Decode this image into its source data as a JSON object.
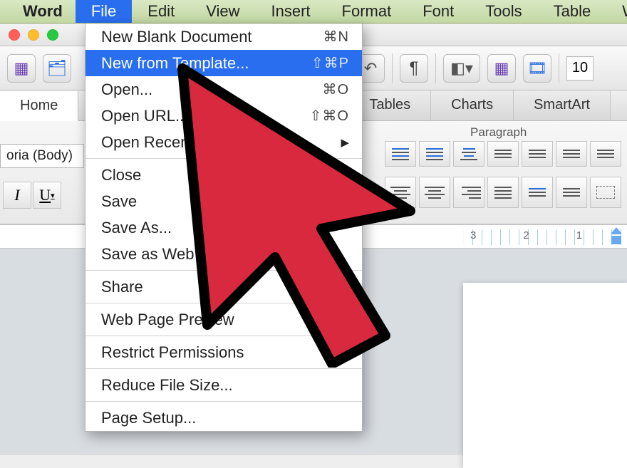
{
  "menubar": {
    "app_name": "Word",
    "items": [
      "File",
      "Edit",
      "View",
      "Insert",
      "Format",
      "Font",
      "Tools",
      "Table",
      "W"
    ],
    "active_index": 0
  },
  "dropdown": {
    "highlight_index": 1,
    "groups": [
      [
        {
          "label": "New Blank Document",
          "shortcut": "⌘N"
        },
        {
          "label": "New from Template...",
          "shortcut": "⇧⌘P"
        },
        {
          "label": "Open...",
          "shortcut": "⌘O"
        },
        {
          "label": "Open URL...",
          "shortcut": "⇧⌘O"
        },
        {
          "label": "Open Recent",
          "submenu": true
        }
      ],
      [
        {
          "label": "Close"
        },
        {
          "label": "Save"
        },
        {
          "label": "Save As..."
        },
        {
          "label": "Save as Web Page..."
        }
      ],
      [
        {
          "label": "Share",
          "submenu": true
        }
      ],
      [
        {
          "label": "Web Page Preview"
        }
      ],
      [
        {
          "label": "Restrict Permissions",
          "submenu": true
        }
      ],
      [
        {
          "label": "Reduce File Size..."
        }
      ],
      [
        {
          "label": "Page Setup..."
        }
      ]
    ]
  },
  "toolbar": {
    "font_size_value": "10"
  },
  "ribbon": {
    "tabs": [
      "Home",
      "Tables",
      "Charts",
      "SmartArt"
    ],
    "active_tab_index": 0,
    "paragraph_group_label": "Paragraph",
    "font_name_value": "oria (Body)"
  },
  "ruler": {
    "numbers": [
      "3",
      "2",
      "1"
    ]
  }
}
